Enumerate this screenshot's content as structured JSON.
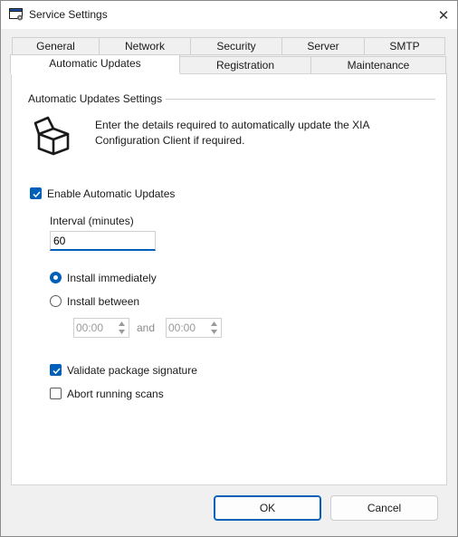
{
  "window": {
    "title": "Service Settings",
    "close_glyph": "✕"
  },
  "tabs_row1": [
    "General",
    "Network",
    "Security",
    "Server",
    "SMTP"
  ],
  "tabs_row2": [
    "Automatic Updates",
    "Registration",
    "Maintenance"
  ],
  "active_tab": "Automatic Updates",
  "group": {
    "title": "Automatic Updates Settings",
    "description": "Enter the details required to automatically update the XIA Configuration Client if required."
  },
  "enable_updates": {
    "label": "Enable Automatic Updates",
    "checked": true
  },
  "interval": {
    "label": "Interval (minutes)",
    "value": "60"
  },
  "install_immediately": {
    "label": "Install immediately",
    "selected": true
  },
  "install_between": {
    "label": "Install between",
    "selected": false,
    "start": "00:00",
    "and_label": "and",
    "end": "00:00"
  },
  "validate_signature": {
    "label": "Validate package signature",
    "checked": true
  },
  "abort_scans": {
    "label": "Abort running scans",
    "checked": false
  },
  "buttons": {
    "ok": "OK",
    "cancel": "Cancel"
  },
  "colors": {
    "accent": "#005fb8",
    "panel": "#ffffff",
    "background": "#f0f0f0"
  },
  "icons": [
    "window-app-icon",
    "close-icon",
    "box-update-icon",
    "checkmark-icon",
    "spin-up-icon",
    "spin-down-icon"
  ]
}
